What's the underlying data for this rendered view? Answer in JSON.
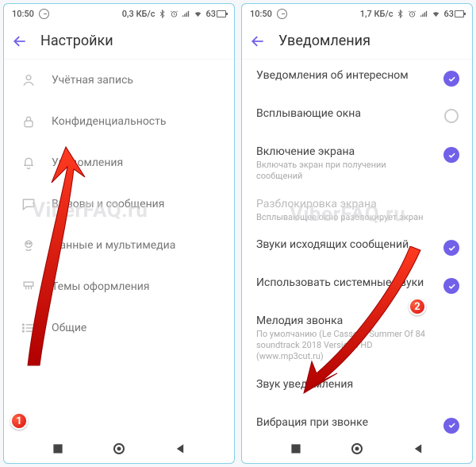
{
  "watermark": "ViberFAQ.ru",
  "statusbar": {
    "time": "10:50",
    "net_left": "0,3 КБ/с",
    "net_right": "1,7 КБ/с",
    "battery": "63"
  },
  "left": {
    "title": "Настройки",
    "items": [
      {
        "label": "Учётная запись"
      },
      {
        "label": "Конфиденциальность"
      },
      {
        "label": "Уведомления"
      },
      {
        "label": "Вызовы и сообщения"
      },
      {
        "label": "Данные и мультимедиа"
      },
      {
        "label": "Темы оформления"
      },
      {
        "label": "Общие"
      }
    ]
  },
  "right": {
    "title": "Уведомления",
    "items": [
      {
        "title": "Уведомления об интересном",
        "sub": "",
        "state": "on"
      },
      {
        "title": "Всплывающие окна",
        "sub": "",
        "state": "off"
      },
      {
        "title": "Включение экрана",
        "sub": "Включать экран при получении сообщений",
        "state": "on"
      },
      {
        "title": "Разблокировка экрана",
        "sub": "Всплывающее окно разблокирует экран",
        "state": "disabled"
      },
      {
        "title": "Звуки исходящих сообщений",
        "sub": "",
        "state": "on"
      },
      {
        "title": "Использовать системные звуки",
        "sub": "",
        "state": "on"
      },
      {
        "title": "Мелодия звонка",
        "sub": "По умолчанию (Le Cassos - Summer Of 84 soundtrack 2018 Version). HD (www.mp3cut.ru)",
        "state": "none"
      },
      {
        "title": "Звук уведомления",
        "sub": "",
        "state": "none"
      },
      {
        "title": "Вибрация при звонке",
        "sub": "",
        "state": "on"
      }
    ]
  },
  "annotations": {
    "badge1": "1",
    "badge2": "2"
  }
}
